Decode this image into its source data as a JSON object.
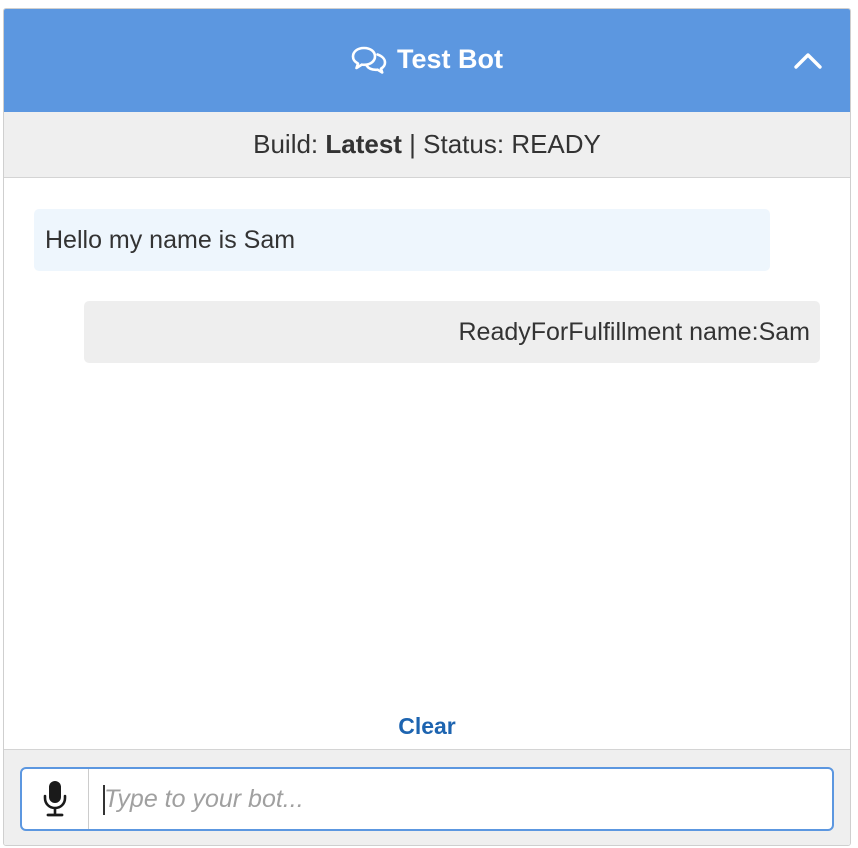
{
  "header": {
    "title": "Test Bot"
  },
  "status": {
    "build_prefix": "Build: ",
    "build_value": "Latest",
    "separator": " | ",
    "status_prefix": "Status: ",
    "status_value": "READY"
  },
  "conversation": {
    "messages": [
      {
        "sender": "user",
        "text": "Hello my name is Sam"
      },
      {
        "sender": "bot",
        "text": "ReadyForFulfillment name:Sam"
      }
    ]
  },
  "clear_label": "Clear",
  "input": {
    "placeholder": "Type to your bot...",
    "value": ""
  },
  "colors": {
    "header_bg": "#5c97e0",
    "user_bubble": "#eef6fd",
    "bot_bubble": "#eeeeee",
    "link": "#1d64b0"
  },
  "icons": {
    "header": "chat-bubbles-icon",
    "collapse": "chevron-up-icon",
    "microphone": "microphone-icon"
  }
}
